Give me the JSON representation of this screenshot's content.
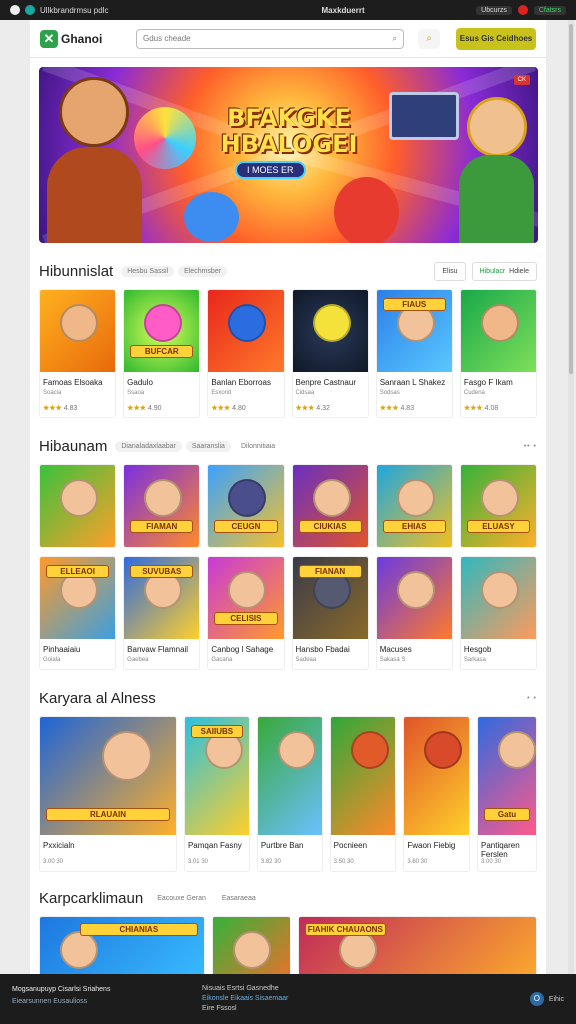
{
  "topbar": {
    "left_text": "Ullkbrandrmsu pdlc",
    "center_text": "Maxkduerrt",
    "right_a": "Ubcurzs",
    "right_b": "Cfatsrs"
  },
  "header": {
    "logo": "Ghanoi",
    "search_placeholder": "Gdus cheade",
    "cta": "Esus Gis Ceidhoes"
  },
  "hero": {
    "title": "BFAKGKE HBALOGEI",
    "button": "I MOES ER",
    "badge": "CK"
  },
  "section1": {
    "title": "Hibunnislat",
    "chips": [
      "Hesbu Sassil",
      "Elechmsber"
    ],
    "tabs": [
      "Elisu",
      "Hibulacr",
      "Hdiele"
    ],
    "cards": [
      {
        "name": "Famoas Elsoaka",
        "sub": "Soacia",
        "stars": "★★★",
        "score": "4.83",
        "label": ""
      },
      {
        "name": "Gadulo",
        "sub": "Ssaoa",
        "stars": "★★★",
        "score": "4.90",
        "label": "BUFCAR"
      },
      {
        "name": "Banlan Eborroas",
        "sub": "Esxorid",
        "stars": "★★★",
        "score": "4.80",
        "label": ""
      },
      {
        "name": "Benpre Castnaur",
        "sub": "Cidsaa",
        "stars": "★★★",
        "score": "4.32",
        "label": ""
      },
      {
        "name": "Sanraan L Shakez",
        "sub": "Sodsas",
        "stars": "★★★",
        "score": "4.83",
        "label": "FIAUS"
      },
      {
        "name": "Fasgo F Ikam",
        "sub": "Cudena",
        "stars": "★★★",
        "score": "4.08",
        "label": ""
      }
    ]
  },
  "section2": {
    "title": "Hibaunam",
    "chips": [
      "Dianaladaxlaabar",
      "Saaranslia",
      "Dilonnitiaia"
    ],
    "more": "•• •",
    "row1": [
      {
        "label": ""
      },
      {
        "label": "FIAMAN"
      },
      {
        "label": "CEUGN"
      },
      {
        "label": "CIUKIAS"
      },
      {
        "label": "EHIAS"
      },
      {
        "label": "ELUASY"
      }
    ],
    "row2": [
      {
        "name": "Pinhaaiaiu",
        "sub": "Goiala",
        "label": "ELLEAOI"
      },
      {
        "name": "Banvaw Flamnail",
        "sub": "Gaebea",
        "label": "SUVUBAS"
      },
      {
        "name": "Canbog l Sahage",
        "sub": "Gacana",
        "label": "CELISIS"
      },
      {
        "name": "Hansbo Fbadai",
        "sub": "Sadeaa",
        "label": "FIANAN"
      },
      {
        "name": "Macuses",
        "sub": "Sakasa S",
        "label": ""
      },
      {
        "name": "Hesgob",
        "sub": "Sarkasa",
        "label": ""
      }
    ]
  },
  "section3": {
    "title": "Karyara al Alness",
    "more": "• •",
    "cards": [
      {
        "name": "Pxxicialn",
        "sub": "3.00 30",
        "label": "RLAUAIN"
      },
      {
        "name": "Pamqan Fasny",
        "sub": "3.01 30",
        "label": "SAIIUBS"
      },
      {
        "name": "Purtbre Ban",
        "sub": "3.82 30",
        "label": ""
      },
      {
        "name": "Pocnieen",
        "sub": "3.50 30",
        "label": ""
      },
      {
        "name": "Fwaon Fiebig",
        "sub": "3.60 30",
        "label": ""
      },
      {
        "name": "Pantiqaren Ferslen",
        "sub": "3.00 30",
        "label": "Gatu"
      }
    ]
  },
  "section4": {
    "title": "Karpcarklimaun",
    "chips": [
      "Eacouxe Geran",
      "Easaraeaa"
    ],
    "labels": [
      "CHIANIAS",
      "",
      "FIAHIK CHAUAONS"
    ]
  },
  "footer": {
    "line1": "Mogsanupuyp Cisarlsi Sriahens",
    "line2": "Eiearsunnen Eusaulioss",
    "mid1": "Nisuais Esrtsi Gasnedhe",
    "mid2": "Eikonsle Eikaais Sisaemaar",
    "mid3": "Eire Fssosl",
    "right": "Eihic",
    "circle": "O"
  }
}
